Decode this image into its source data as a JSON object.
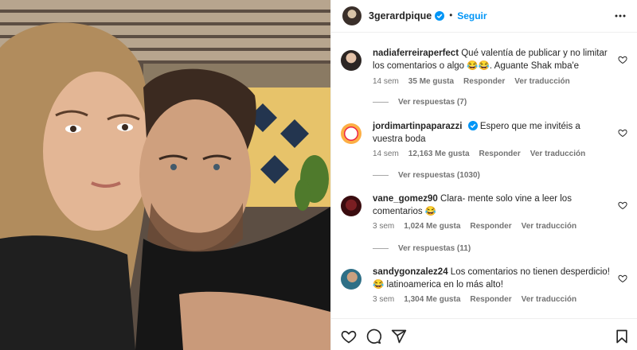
{
  "post": {
    "username": "3gerardpique",
    "follow_label": "Seguir",
    "dot": "•",
    "photo_alt": "selfie"
  },
  "comments": [
    {
      "username": "nadiaferreiraperfect",
      "text": "Qué valentía de publicar y no limitar los comentarios o algo 😂😂. Aguante Shak mba'e",
      "age": "14 sem",
      "likes": "35 Me gusta",
      "reply_label": "Responder",
      "translate_label": "Ver traducción",
      "replies_label": "Ver respuestas (7)",
      "verified": false
    },
    {
      "username": "jordimartinpaparazzi",
      "text": "Espero que me invitéis a vuestra boda",
      "age": "14 sem",
      "likes": "12,163 Me gusta",
      "reply_label": "Responder",
      "translate_label": "Ver traducción",
      "replies_label": "Ver respuestas (1030)",
      "verified": true
    },
    {
      "username": "vane_gomez90",
      "text": "Clara- mente solo vine a leer los comentarios 😂",
      "age": "3 sem",
      "likes": "1,024 Me gusta",
      "reply_label": "Responder",
      "translate_label": "Ver traducción",
      "replies_label": "Ver respuestas (11)",
      "verified": false
    },
    {
      "username": "sandygonzalez24",
      "text": "Los comentarios no tienen desperdicio! 😂 latinoamerica en lo más alto!",
      "age": "3 sem",
      "likes": "1,304 Me gusta",
      "reply_label": "Responder",
      "translate_label": "Ver traducción",
      "verified": false
    }
  ],
  "icons": {
    "like": "heart-icon",
    "comment": "comment-icon",
    "share": "share-icon",
    "save": "bookmark-icon",
    "more": "more-options-icon",
    "verified": "verified-badge-icon"
  },
  "colors": {
    "accent": "#0095f6",
    "meta": "#737373",
    "text": "#262626"
  }
}
